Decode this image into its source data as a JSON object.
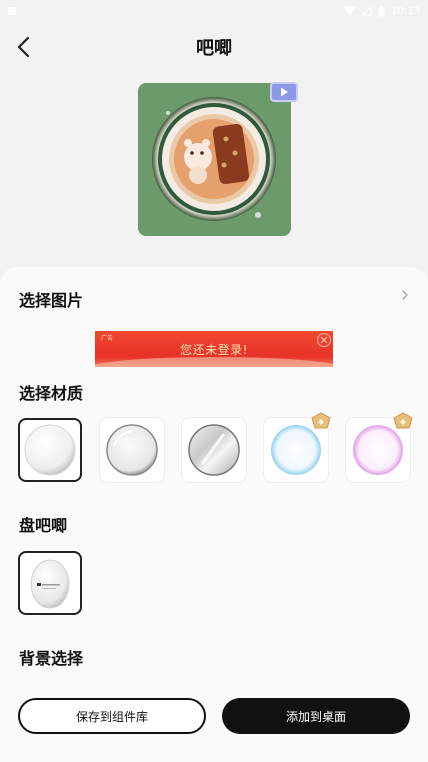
{
  "status_bar": {
    "time": "10:13"
  },
  "header": {
    "title": "吧唧"
  },
  "sections": {
    "select_image": "选择图片",
    "select_material": "选择材质",
    "pan_badge": "盘吧唧",
    "background_select": "背景选择"
  },
  "ad": {
    "tag": "广告",
    "text": "您还未登录!"
  },
  "materials": [
    {
      "name": "plain-white",
      "selected": true,
      "vip": false
    },
    {
      "name": "glossy-white",
      "selected": false,
      "vip": false
    },
    {
      "name": "metallic-silver",
      "selected": false,
      "vip": false
    },
    {
      "name": "iridescent-blue",
      "selected": false,
      "vip": true
    },
    {
      "name": "iridescent-pink",
      "selected": false,
      "vip": true
    }
  ],
  "buttons": {
    "save_to_library": "保存到组件库",
    "add_to_desktop": "添加到桌面"
  },
  "colors": {
    "preview_bg": "#6d9a6a",
    "primary": "#111111",
    "ad_red": "#e8312a",
    "vip_gold": "#e6c07a"
  }
}
